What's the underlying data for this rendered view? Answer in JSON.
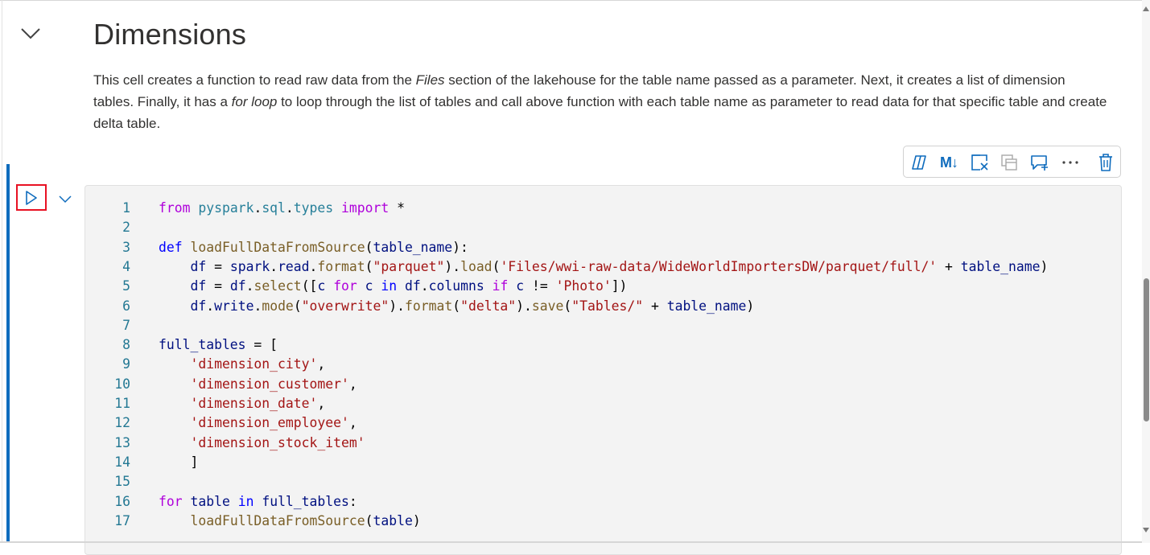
{
  "markdown_cell": {
    "heading": "Dimensions",
    "description": {
      "t1": "This cell creates a function to read raw data from the ",
      "em1": "Files",
      "t2": " section of the lakehouse for the table name passed as a parameter. Next, it creates a list of dimension tables. Finally, it has a ",
      "em2": "for loop",
      "t3": " to loop through the list of tables and call above function with each table name as parameter to read data for that specific table and create delta table."
    }
  },
  "toolbar": {
    "copilot_icon": "copilot-icon",
    "markdown_label": "M↓",
    "items": [
      "copilot-icon",
      "markdown-toggle",
      "clear-output-icon",
      "copy-cell-icon",
      "add-comment-icon",
      "more-icon",
      "delete-icon"
    ],
    "more_label": "···"
  },
  "colors": {
    "accent": "#0f6cbd",
    "run_highlight": "#e81123",
    "code_bg": "#f3f3f3",
    "keyword": "#af00db",
    "string": "#a31515",
    "function": "#795e26",
    "variable": "#001080",
    "module": "#267f99",
    "line_number": "#237893"
  },
  "code": {
    "lines": [
      {
        "n": "1",
        "t": [
          [
            "kw",
            "from"
          ],
          [
            "p",
            " "
          ],
          [
            "mod",
            "pyspark"
          ],
          [
            "p",
            "."
          ],
          [
            "mod",
            "sql"
          ],
          [
            "p",
            "."
          ],
          [
            "mod",
            "types"
          ],
          [
            "p",
            " "
          ],
          [
            "kw",
            "import"
          ],
          [
            "p",
            " *"
          ]
        ]
      },
      {
        "n": "2",
        "t": []
      },
      {
        "n": "3",
        "t": [
          [
            "kb",
            "def"
          ],
          [
            "p",
            " "
          ],
          [
            "fn",
            "loadFullDataFromSource"
          ],
          [
            "p",
            "("
          ],
          [
            "vr",
            "table_name"
          ],
          [
            "p",
            "):"
          ]
        ]
      },
      {
        "n": "4",
        "t": [
          [
            "p",
            "    "
          ],
          [
            "vr",
            "df"
          ],
          [
            "p",
            " = "
          ],
          [
            "vr",
            "spark"
          ],
          [
            "p",
            "."
          ],
          [
            "vr",
            "read"
          ],
          [
            "p",
            "."
          ],
          [
            "fn",
            "format"
          ],
          [
            "p",
            "("
          ],
          [
            "str",
            "\"parquet\""
          ],
          [
            "p",
            ")."
          ],
          [
            "fn",
            "load"
          ],
          [
            "p",
            "("
          ],
          [
            "str",
            "'Files/wwi-raw-data/WideWorldImportersDW/parquet/full/'"
          ],
          [
            "p",
            " + "
          ],
          [
            "vr",
            "table_name"
          ],
          [
            "p",
            ")"
          ]
        ]
      },
      {
        "n": "5",
        "t": [
          [
            "p",
            "    "
          ],
          [
            "vr",
            "df"
          ],
          [
            "p",
            " = "
          ],
          [
            "vr",
            "df"
          ],
          [
            "p",
            "."
          ],
          [
            "fn",
            "select"
          ],
          [
            "p",
            "(["
          ],
          [
            "vr",
            "c"
          ],
          [
            "p",
            " "
          ],
          [
            "kw",
            "for"
          ],
          [
            "p",
            " "
          ],
          [
            "vr",
            "c"
          ],
          [
            "p",
            " "
          ],
          [
            "kb",
            "in"
          ],
          [
            "p",
            " "
          ],
          [
            "vr",
            "df"
          ],
          [
            "p",
            "."
          ],
          [
            "vr",
            "columns"
          ],
          [
            "p",
            " "
          ],
          [
            "kw",
            "if"
          ],
          [
            "p",
            " "
          ],
          [
            "vr",
            "c"
          ],
          [
            "p",
            " != "
          ],
          [
            "str",
            "'Photo'"
          ],
          [
            "p",
            "])"
          ]
        ]
      },
      {
        "n": "6",
        "t": [
          [
            "p",
            "    "
          ],
          [
            "vr",
            "df"
          ],
          [
            "p",
            "."
          ],
          [
            "vr",
            "write"
          ],
          [
            "p",
            "."
          ],
          [
            "fn",
            "mode"
          ],
          [
            "p",
            "("
          ],
          [
            "str",
            "\"overwrite\""
          ],
          [
            "p",
            ")."
          ],
          [
            "fn",
            "format"
          ],
          [
            "p",
            "("
          ],
          [
            "str",
            "\"delta\""
          ],
          [
            "p",
            ")."
          ],
          [
            "fn",
            "save"
          ],
          [
            "p",
            "("
          ],
          [
            "str",
            "\"Tables/\""
          ],
          [
            "p",
            " + "
          ],
          [
            "vr",
            "table_name"
          ],
          [
            "p",
            ")"
          ]
        ]
      },
      {
        "n": "7",
        "t": []
      },
      {
        "n": "8",
        "t": [
          [
            "vr",
            "full_tables"
          ],
          [
            "p",
            " = ["
          ]
        ]
      },
      {
        "n": "9",
        "t": [
          [
            "p",
            "    "
          ],
          [
            "str",
            "'dimension_city'"
          ],
          [
            "p",
            ","
          ]
        ]
      },
      {
        "n": "10",
        "t": [
          [
            "p",
            "    "
          ],
          [
            "str",
            "'dimension_customer'"
          ],
          [
            "p",
            ","
          ]
        ]
      },
      {
        "n": "11",
        "t": [
          [
            "p",
            "    "
          ],
          [
            "str",
            "'dimension_date'"
          ],
          [
            "p",
            ","
          ]
        ]
      },
      {
        "n": "12",
        "t": [
          [
            "p",
            "    "
          ],
          [
            "str",
            "'dimension_employee'"
          ],
          [
            "p",
            ","
          ]
        ]
      },
      {
        "n": "13",
        "t": [
          [
            "p",
            "    "
          ],
          [
            "str",
            "'dimension_stock_item'"
          ]
        ]
      },
      {
        "n": "14",
        "t": [
          [
            "p",
            "    ]"
          ]
        ]
      },
      {
        "n": "15",
        "t": []
      },
      {
        "n": "16",
        "t": [
          [
            "kw",
            "for"
          ],
          [
            "p",
            " "
          ],
          [
            "vr",
            "table"
          ],
          [
            "p",
            " "
          ],
          [
            "kb",
            "in"
          ],
          [
            "p",
            " "
          ],
          [
            "vr",
            "full_tables"
          ],
          [
            "p",
            ":"
          ]
        ]
      },
      {
        "n": "17",
        "t": [
          [
            "p",
            "    "
          ],
          [
            "fn",
            "loadFullDataFromSource"
          ],
          [
            "p",
            "("
          ],
          [
            "vr",
            "table"
          ],
          [
            "p",
            ")"
          ]
        ]
      }
    ]
  }
}
